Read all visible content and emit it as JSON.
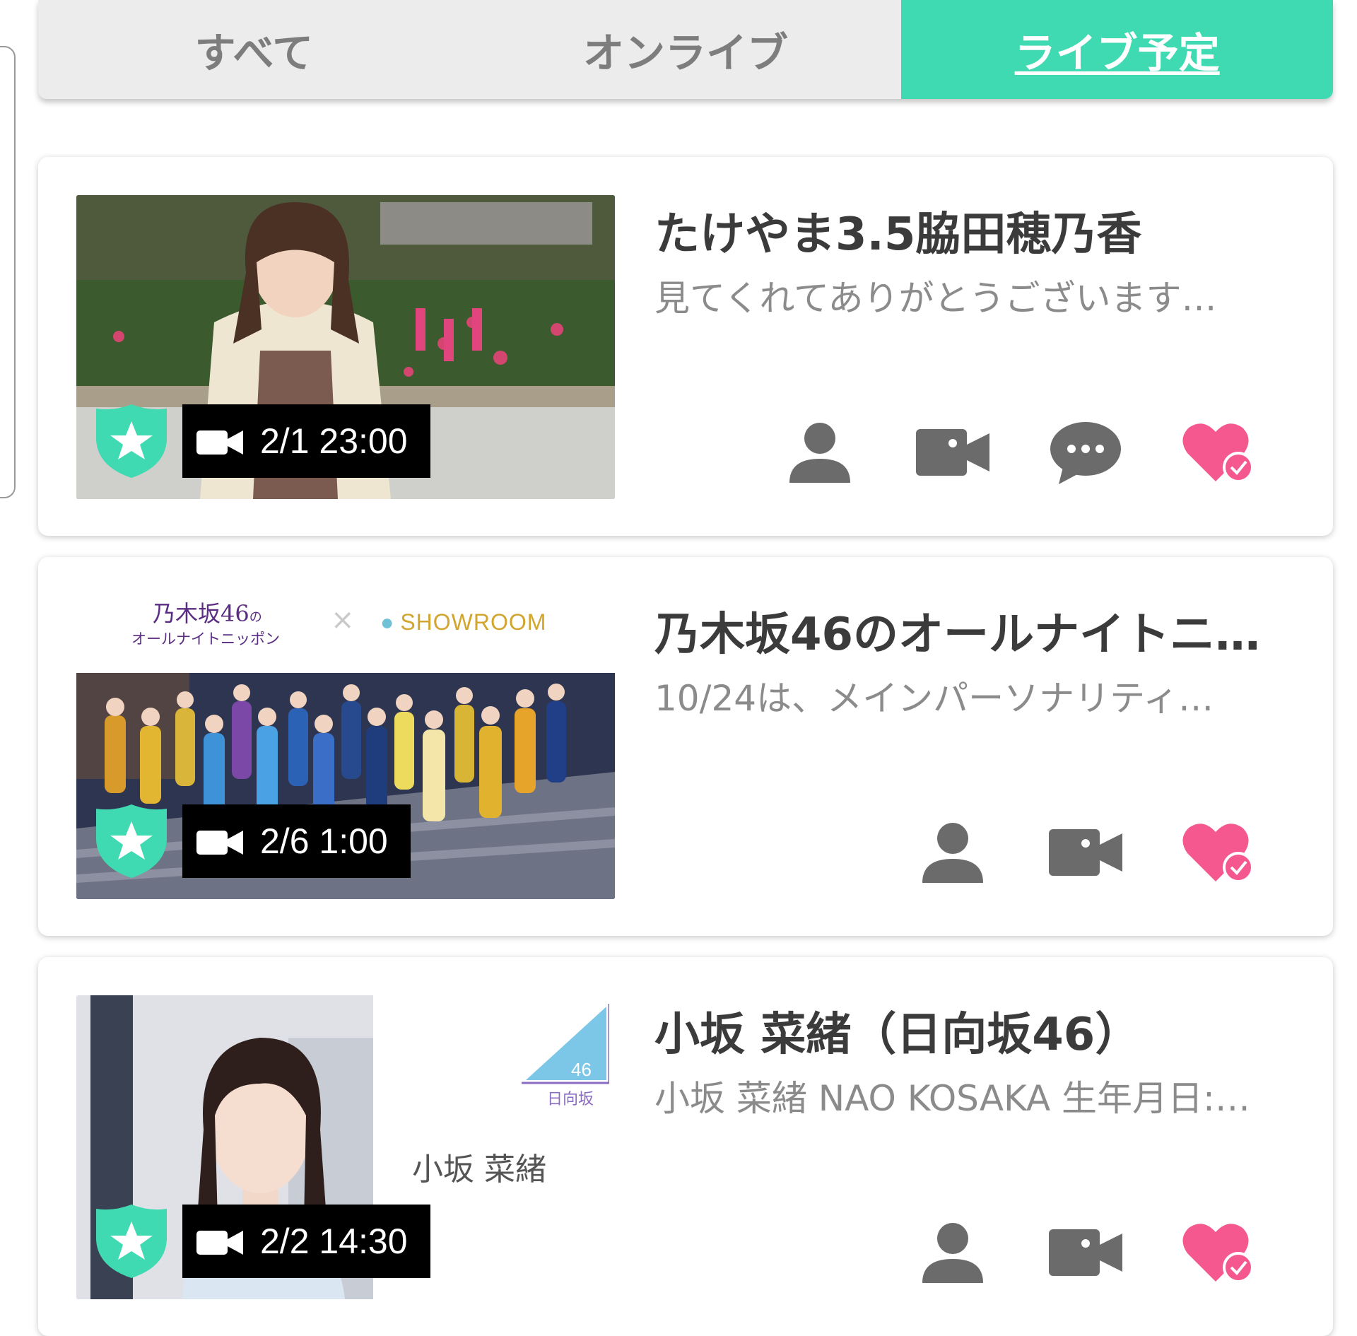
{
  "tabs": [
    {
      "label": "すべて",
      "active": false
    },
    {
      "label": "オンライブ",
      "active": false
    },
    {
      "label": "ライブ予定",
      "active": true
    }
  ],
  "colors": {
    "accent": "#3fdab1",
    "heart": "#f5588e",
    "icon_gray": "#6b6b6b"
  },
  "cards": [
    {
      "title": "たけやま3.5脇田穂乃香",
      "description": "見てくれてありがとうございます…",
      "schedule": "2/1 23:00",
      "actions": [
        "person-icon",
        "video-camera-icon",
        "chat-bubble-icon",
        "heart-check-icon"
      ]
    },
    {
      "title": "乃木坂46のオールナイトニ…",
      "description": "10/24は、メインパーソナリティ…",
      "schedule": "2/6 1:00",
      "banner": {
        "line1": "乃木坂46",
        "line1_suffix": "の",
        "line2": "オールナイトニッポン",
        "cross": "×",
        "brand": "SHOWROOM"
      },
      "actions": [
        "person-icon",
        "video-camera-icon",
        "heart-check-icon"
      ]
    },
    {
      "title": "小坂 菜緒（日向坂46）",
      "description": "小坂 菜緒 NAO KOSAKA 生年月日:…",
      "schedule": "2/2 14:30",
      "photo_caption": "小坂 菜緒",
      "logo": {
        "number": "46",
        "text": "日向坂"
      },
      "actions": [
        "person-icon",
        "video-camera-icon",
        "heart-check-icon"
      ]
    }
  ]
}
